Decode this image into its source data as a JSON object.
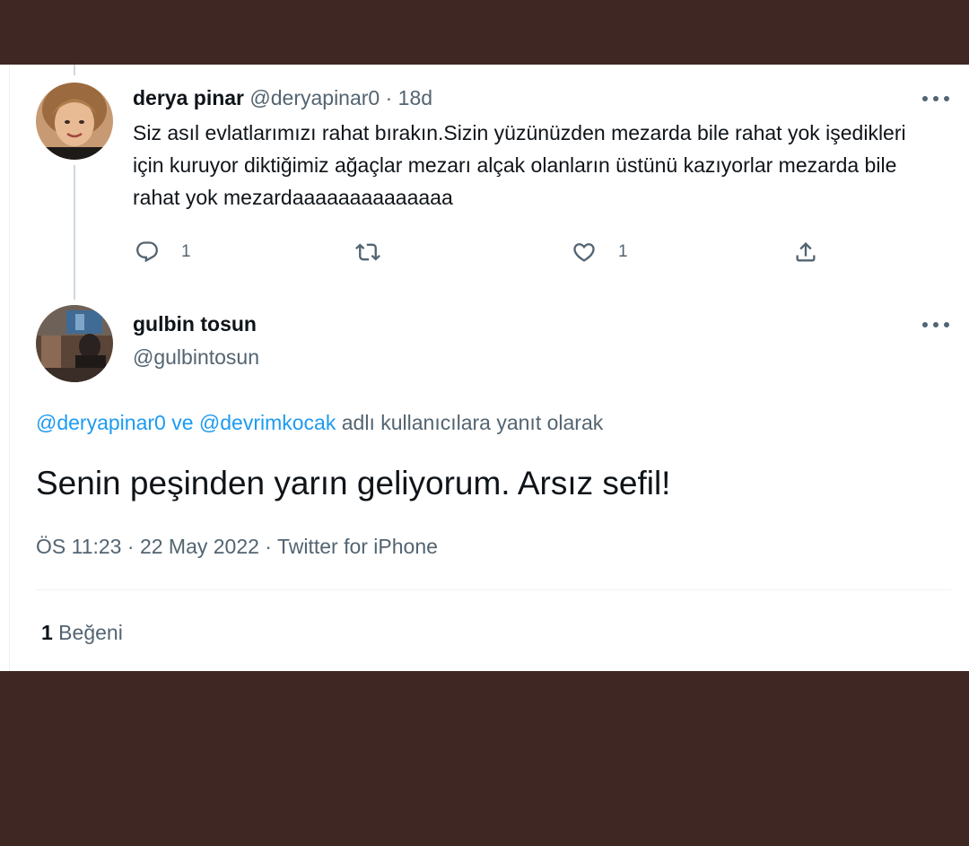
{
  "reply_tweet": {
    "display_name": "derya pinar",
    "handle": "@deryapinar0",
    "separator": "·",
    "age": "18d",
    "text": "Siz asıl evlatlarımızı rahat bırakın.Sizin yüzünüzden mezarda bile rahat yok işedikleri için kuruyor diktiğimiz ağaçlar mezarı alçak olanların üstünü kazıyorlar mezarda bile rahat yok mezardaaaaaaaaaaaaaa",
    "actions": {
      "reply_count": "1",
      "retweet_count": "",
      "like_count": "1"
    },
    "icons": [
      "comment-icon",
      "retweet-icon",
      "heart-icon",
      "share-icon",
      "more-icon"
    ]
  },
  "main_tweet": {
    "display_name": "gulbin tosun",
    "handle": "@gulbintosun",
    "replying_to": {
      "mention_1": "@deryapinar0",
      "conjunction": " ve ",
      "mention_2": "@devrimkocak",
      "suffix": " adlı kullanıcılara yanıt olarak"
    },
    "text": "Senin peşinden yarın geliyorum. Arsız sefil!",
    "time": "ÖS 11:23",
    "separator": " · ",
    "date": "22 May 2022",
    "source": "Twitter for iPhone",
    "likes": {
      "count": "1",
      "label": " Beğeni"
    }
  },
  "colors": {
    "background": "#3f2723",
    "card": "#ffffff",
    "text_primary": "#0f1419",
    "text_secondary": "#536471",
    "link": "#1d9bf0"
  }
}
